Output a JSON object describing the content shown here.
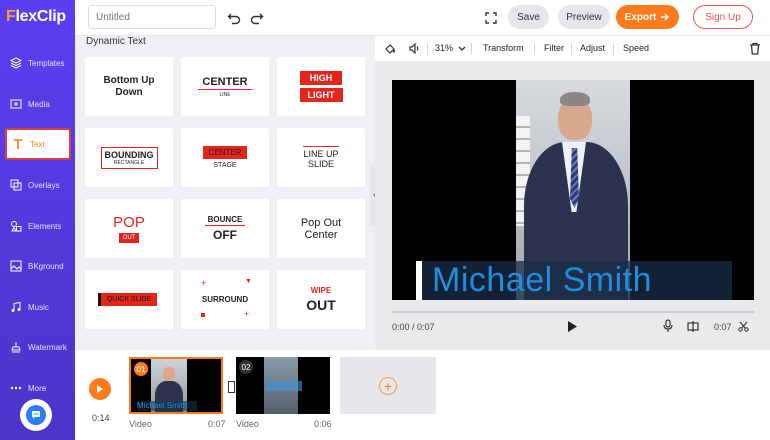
{
  "app": {
    "logo": "FlexClip",
    "logo_accent": "#ff9a3c"
  },
  "sidebar": {
    "items": [
      {
        "label": "Templates",
        "icon": "layers-icon"
      },
      {
        "label": "Media",
        "icon": "media-icon"
      },
      {
        "label": "Text",
        "icon": "text-icon",
        "active": true
      },
      {
        "label": "Overlays",
        "icon": "overlays-icon"
      },
      {
        "label": "Elements",
        "icon": "elements-icon"
      },
      {
        "label": "BKground",
        "icon": "background-icon"
      },
      {
        "label": "Music",
        "icon": "music-icon"
      },
      {
        "label": "Watermark",
        "icon": "watermark-icon"
      },
      {
        "label": "More",
        "icon": "more-icon"
      }
    ]
  },
  "topbar": {
    "title_placeholder": "Untitled",
    "save": "Save",
    "preview": "Preview",
    "export": "Export",
    "signup": "Sign Up"
  },
  "panel": {
    "title": "Dynamic Text",
    "cards": [
      {
        "lines": [
          "Bottom Up",
          "Down"
        ]
      },
      {
        "lines": [
          "CENTER",
          "LINE"
        ]
      },
      {
        "lines": [
          "HIGH",
          "LIGHT"
        ]
      },
      {
        "lines": [
          "BOUNDING",
          "RECTANGLE"
        ]
      },
      {
        "lines": [
          "CENTER",
          "STAGE"
        ]
      },
      {
        "lines": [
          "LINE UP",
          "SLIDE"
        ]
      },
      {
        "lines": [
          "POP",
          "OUT"
        ]
      },
      {
        "lines": [
          "BOUNCE",
          "OFF"
        ]
      },
      {
        "lines": [
          "Pop Out",
          "Center"
        ]
      },
      {
        "lines": [
          "QUICK SLIDE"
        ]
      },
      {
        "lines": [
          "SURROUND"
        ]
      },
      {
        "lines": [
          "WIPE",
          "OUT"
        ]
      }
    ]
  },
  "tools": {
    "zoom": "31%",
    "transform": "Transform",
    "filter": "Filter",
    "adjust": "Adjust",
    "speed": "Speed"
  },
  "preview": {
    "caption": "Michael Smith",
    "time_current": "0:00 / 0:07",
    "time_total": "0:07"
  },
  "timeline": {
    "duration": "0:14",
    "clips": [
      {
        "num": "01",
        "label": "Video",
        "duration": "0:07"
      },
      {
        "num": "02",
        "label": "Video",
        "duration": "0:06"
      }
    ]
  },
  "colors": {
    "accent": "#ff7a1a",
    "sidebar": "#5a3ff0",
    "caption": "#1f8ee0",
    "signup": "#e8554e"
  }
}
